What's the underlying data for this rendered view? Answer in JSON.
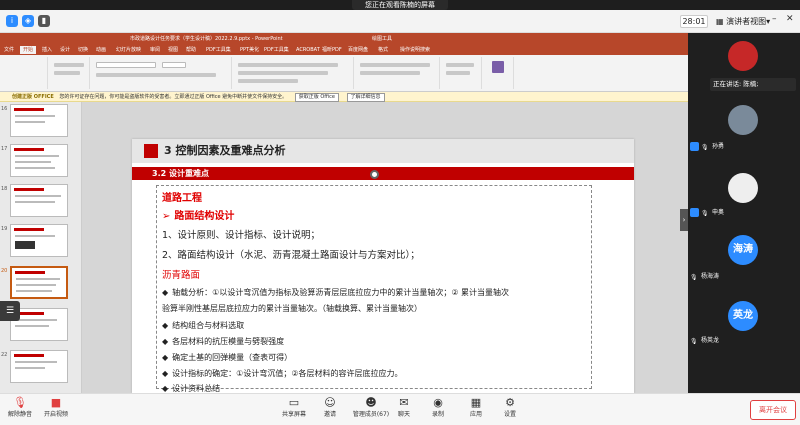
{
  "banner": "您正在观看陈楠的屏幕",
  "topbar": {
    "timer": "28:01",
    "view_label": "演讲者视图",
    "view_caret": "▾",
    "minimize": "–",
    "close": "✕"
  },
  "powerpoint": {
    "window_title": "市政道路设计任务要求（学生设计稿）2022.2.9.pptx - PowerPoint",
    "tool_context": "绘图工具",
    "tabs": [
      "文件",
      "开始",
      "插入",
      "设计",
      "切换",
      "动画",
      "幻灯片放映",
      "审阅",
      "视图",
      "帮助",
      "PDF工具集",
      "PPT美化",
      "PDF工具集",
      "ACROBAT",
      "福昕PDF",
      "百度网盘",
      "格式",
      "操作说明搜索"
    ],
    "active_tab": "开始",
    "info_tag": "创建正版 OFFICE",
    "info_text": "您的许可证存在问题，你可能是盗版软件的受害者。立即通过正版 Office 避免中断并使文件保持安全。",
    "info_btn1": "获取正版 Office",
    "info_btn2": "了解详细信息",
    "thumb_numbers": [
      "16",
      "17",
      "18",
      "19",
      "20",
      "21",
      "22"
    ],
    "side_handle_icon": "☰"
  },
  "slide": {
    "title": "3 控制因素及重难点分析",
    "subtitle": "3.2 设计重难点",
    "lines": [
      {
        "text": "道路工程",
        "style": "h-red",
        "bullet": ""
      },
      {
        "text": "路面结构设计",
        "style": "h-red",
        "bullet": "➢"
      },
      {
        "text": "1、设计原则、设计指标、设计说明；",
        "style": "t-normal",
        "bullet": ""
      },
      {
        "text": "2、路面结构设计（水泥、沥青混凝土路面设计与方案对比）；",
        "style": "t-normal",
        "bullet": ""
      },
      {
        "text": "沥青路面",
        "style": "red-plain",
        "bullet": ""
      },
      {
        "text": "轴载分析：①以设计弯沉值为指标及验算沥青层层底拉应力中的累计当量轴次；② 累计当量轴次",
        "style": "t-small",
        "bullet": "◆"
      },
      {
        "text": "验算半刚性基层层底拉应力的累计当量轴次。（轴载换算、累计当量轴次）",
        "style": "t-small",
        "bullet": ""
      },
      {
        "text": "结构组合与材料选取",
        "style": "t-small",
        "bullet": "◆"
      },
      {
        "text": "各层材料的抗压模量与劈裂强度",
        "style": "t-small",
        "bullet": "◆"
      },
      {
        "text": "确定土基的回弹模量（查表可得）",
        "style": "t-small",
        "bullet": "◆"
      },
      {
        "text": "设计指标的确定：①设计弯沉值；②各层材料的容许层底拉应力。",
        "style": "t-small",
        "bullet": "◆"
      },
      {
        "text": "设计资料总结",
        "style": "t-small",
        "bullet": "◆"
      }
    ]
  },
  "panel": {
    "speaking_label": "正在讲话: 陈楠;",
    "toggle_icon": "›",
    "participants": [
      {
        "name": "",
        "avatar_text": "",
        "avatar_color": "#c62828"
      },
      {
        "name": "孙勇",
        "avatar_text": "",
        "avatar_color": "#7a8a9a"
      },
      {
        "name": "申奥",
        "avatar_text": "",
        "avatar_color": "#eeeeee"
      },
      {
        "name": "杨海涛",
        "avatar_text": "海涛",
        "avatar_color": "#2d8cff"
      },
      {
        "name": "杨英龙",
        "avatar_text": "英龙",
        "avatar_color": "#2d8cff"
      }
    ]
  },
  "toolbar": {
    "mute": "解除静音",
    "video": "开启视频",
    "share": "共享屏幕",
    "invite": "邀请",
    "members": "管理成员(67)",
    "chat": "聊天",
    "record": "录制",
    "apps": "应用",
    "settings": "设置",
    "leave": "离开会议"
  },
  "colors": {
    "ppt_red": "#b7472a",
    "slide_red": "#c00000",
    "zoom_blue": "#2d8cff",
    "leave_red": "#e04040"
  }
}
